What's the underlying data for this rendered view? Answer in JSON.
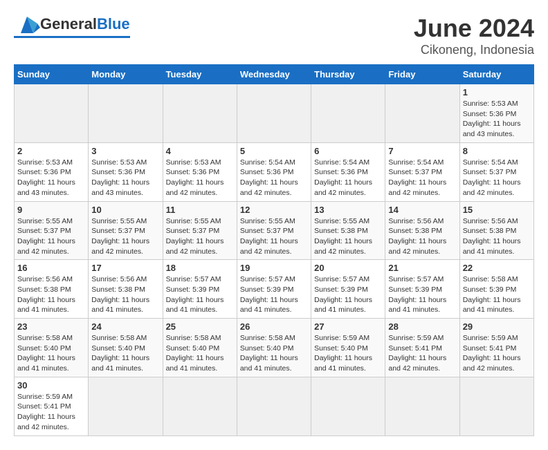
{
  "header": {
    "logo_general": "General",
    "logo_blue": "Blue",
    "title": "June 2024",
    "subtitle": "Cikoneng, Indonesia"
  },
  "days_of_week": [
    "Sunday",
    "Monday",
    "Tuesday",
    "Wednesday",
    "Thursday",
    "Friday",
    "Saturday"
  ],
  "weeks": [
    [
      {
        "day": "",
        "info": ""
      },
      {
        "day": "",
        "info": ""
      },
      {
        "day": "",
        "info": ""
      },
      {
        "day": "",
        "info": ""
      },
      {
        "day": "",
        "info": ""
      },
      {
        "day": "",
        "info": ""
      },
      {
        "day": "1",
        "info": "Sunrise: 5:53 AM\nSunset: 5:36 PM\nDaylight: 11 hours and 43 minutes."
      }
    ],
    [
      {
        "day": "2",
        "info": "Sunrise: 5:53 AM\nSunset: 5:36 PM\nDaylight: 11 hours and 43 minutes."
      },
      {
        "day": "3",
        "info": "Sunrise: 5:53 AM\nSunset: 5:36 PM\nDaylight: 11 hours and 43 minutes."
      },
      {
        "day": "4",
        "info": "Sunrise: 5:53 AM\nSunset: 5:36 PM\nDaylight: 11 hours and 42 minutes."
      },
      {
        "day": "5",
        "info": "Sunrise: 5:54 AM\nSunset: 5:36 PM\nDaylight: 11 hours and 42 minutes."
      },
      {
        "day": "6",
        "info": "Sunrise: 5:54 AM\nSunset: 5:36 PM\nDaylight: 11 hours and 42 minutes."
      },
      {
        "day": "7",
        "info": "Sunrise: 5:54 AM\nSunset: 5:37 PM\nDaylight: 11 hours and 42 minutes."
      },
      {
        "day": "8",
        "info": "Sunrise: 5:54 AM\nSunset: 5:37 PM\nDaylight: 11 hours and 42 minutes."
      }
    ],
    [
      {
        "day": "9",
        "info": "Sunrise: 5:55 AM\nSunset: 5:37 PM\nDaylight: 11 hours and 42 minutes."
      },
      {
        "day": "10",
        "info": "Sunrise: 5:55 AM\nSunset: 5:37 PM\nDaylight: 11 hours and 42 minutes."
      },
      {
        "day": "11",
        "info": "Sunrise: 5:55 AM\nSunset: 5:37 PM\nDaylight: 11 hours and 42 minutes."
      },
      {
        "day": "12",
        "info": "Sunrise: 5:55 AM\nSunset: 5:37 PM\nDaylight: 11 hours and 42 minutes."
      },
      {
        "day": "13",
        "info": "Sunrise: 5:55 AM\nSunset: 5:38 PM\nDaylight: 11 hours and 42 minutes."
      },
      {
        "day": "14",
        "info": "Sunrise: 5:56 AM\nSunset: 5:38 PM\nDaylight: 11 hours and 42 minutes."
      },
      {
        "day": "15",
        "info": "Sunrise: 5:56 AM\nSunset: 5:38 PM\nDaylight: 11 hours and 41 minutes."
      }
    ],
    [
      {
        "day": "16",
        "info": "Sunrise: 5:56 AM\nSunset: 5:38 PM\nDaylight: 11 hours and 41 minutes."
      },
      {
        "day": "17",
        "info": "Sunrise: 5:56 AM\nSunset: 5:38 PM\nDaylight: 11 hours and 41 minutes."
      },
      {
        "day": "18",
        "info": "Sunrise: 5:57 AM\nSunset: 5:39 PM\nDaylight: 11 hours and 41 minutes."
      },
      {
        "day": "19",
        "info": "Sunrise: 5:57 AM\nSunset: 5:39 PM\nDaylight: 11 hours and 41 minutes."
      },
      {
        "day": "20",
        "info": "Sunrise: 5:57 AM\nSunset: 5:39 PM\nDaylight: 11 hours and 41 minutes."
      },
      {
        "day": "21",
        "info": "Sunrise: 5:57 AM\nSunset: 5:39 PM\nDaylight: 11 hours and 41 minutes."
      },
      {
        "day": "22",
        "info": "Sunrise: 5:58 AM\nSunset: 5:39 PM\nDaylight: 11 hours and 41 minutes."
      }
    ],
    [
      {
        "day": "23",
        "info": "Sunrise: 5:58 AM\nSunset: 5:40 PM\nDaylight: 11 hours and 41 minutes."
      },
      {
        "day": "24",
        "info": "Sunrise: 5:58 AM\nSunset: 5:40 PM\nDaylight: 11 hours and 41 minutes."
      },
      {
        "day": "25",
        "info": "Sunrise: 5:58 AM\nSunset: 5:40 PM\nDaylight: 11 hours and 41 minutes."
      },
      {
        "day": "26",
        "info": "Sunrise: 5:58 AM\nSunset: 5:40 PM\nDaylight: 11 hours and 41 minutes."
      },
      {
        "day": "27",
        "info": "Sunrise: 5:59 AM\nSunset: 5:40 PM\nDaylight: 11 hours and 41 minutes."
      },
      {
        "day": "28",
        "info": "Sunrise: 5:59 AM\nSunset: 5:41 PM\nDaylight: 11 hours and 42 minutes."
      },
      {
        "day": "29",
        "info": "Sunrise: 5:59 AM\nSunset: 5:41 PM\nDaylight: 11 hours and 42 minutes."
      }
    ],
    [
      {
        "day": "30",
        "info": "Sunrise: 5:59 AM\nSunset: 5:41 PM\nDaylight: 11 hours and 42 minutes."
      },
      {
        "day": "",
        "info": ""
      },
      {
        "day": "",
        "info": ""
      },
      {
        "day": "",
        "info": ""
      },
      {
        "day": "",
        "info": ""
      },
      {
        "day": "",
        "info": ""
      },
      {
        "day": "",
        "info": ""
      }
    ]
  ]
}
